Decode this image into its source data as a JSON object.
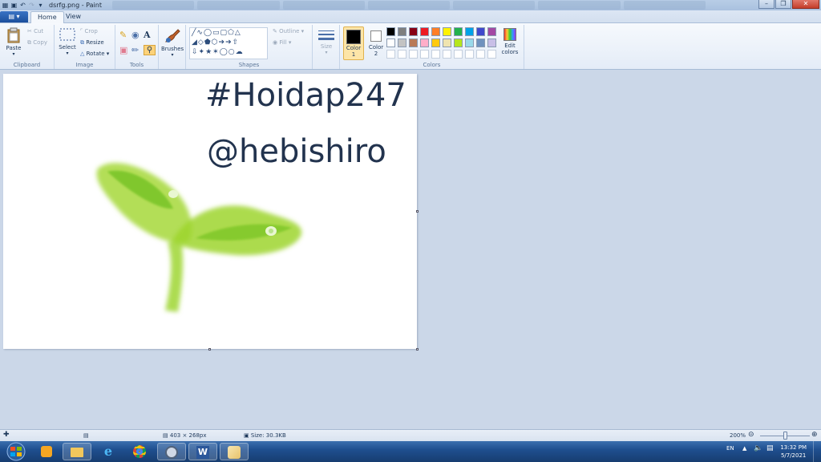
{
  "title_bar": {
    "title": "dsrfg.png - Paint"
  },
  "tabs": {
    "app_menu": "▤ ▾",
    "home": "Home",
    "view": "View"
  },
  "clipboard": {
    "paste": "Paste",
    "cut": "Cut",
    "copy": "Copy",
    "label": "Clipboard"
  },
  "image": {
    "select": "Select",
    "crop": "Crop",
    "resize": "Resize",
    "rotate": "Rotate",
    "label": "Image"
  },
  "tools": {
    "label": "Tools"
  },
  "brushes": {
    "label": "Brushes"
  },
  "shapes": {
    "outline": "Outline",
    "fill": "Fill",
    "label": "Shapes"
  },
  "size": {
    "label": "Size"
  },
  "colors": {
    "color1": "Color",
    "color1_num": "1",
    "color2": "Color",
    "color2_num": "2",
    "edit": "Edit",
    "edit2": "colors",
    "label": "Colors",
    "color1_value": "#000000",
    "color2_value": "#ffffff",
    "palette_row1": [
      "#000000",
      "#7f7f7f",
      "#880015",
      "#ed1c24",
      "#ff7f27",
      "#fff200",
      "#22b14c",
      "#00a2e8",
      "#3f48cc",
      "#a349a4"
    ],
    "palette_row2": [
      "#ffffff",
      "#c3c3c3",
      "#b97a57",
      "#ffaec9",
      "#ffc90e",
      "#efe4b0",
      "#b5e61d",
      "#99d9ea",
      "#7092be",
      "#c8bfe7"
    ]
  },
  "canvas": {
    "line1": "#Hoidap247",
    "line2": "@hebishiro"
  },
  "status": {
    "dimensions": "403 × 268px",
    "size": "Size: 30.3KB",
    "zoom": "200%"
  },
  "taskbar": {
    "lang": "EN",
    "time": "13:32 PM",
    "date": "5/7/2021"
  }
}
